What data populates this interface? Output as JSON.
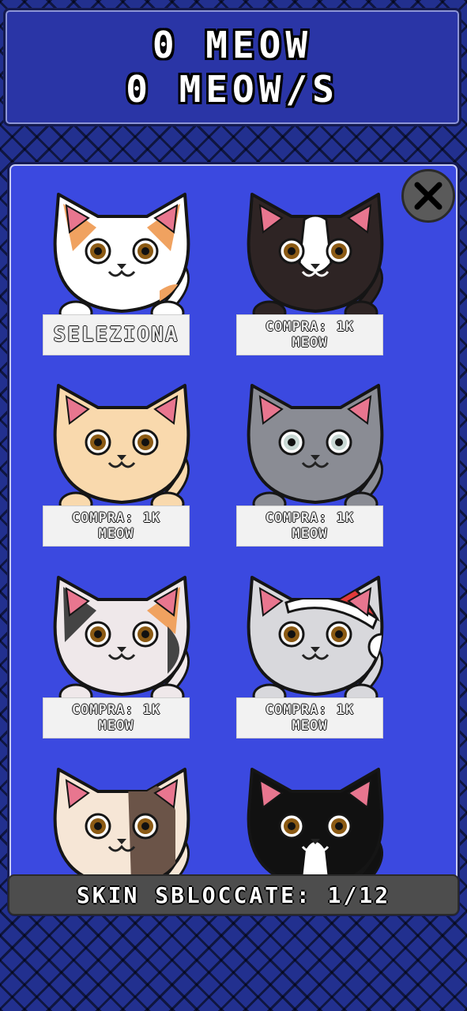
{
  "header": {
    "meow_total": "0 MEOW",
    "meow_rate": "0 MEOW/S"
  },
  "panel": {
    "close_icon": "close-x-icon",
    "skins": [
      {
        "name_icon": "orange-white-cat",
        "button": "SELEZIONA",
        "selected": true,
        "colors": {
          "fur": "#ffffff",
          "patch": "#f0a260"
        }
      },
      {
        "name_icon": "tuxedo-cat",
        "button": "COMPRA: 1K\nMEOW",
        "selected": false,
        "colors": {
          "fur": "#2e2424",
          "patch": "#ffffff"
        }
      },
      {
        "name_icon": "cream-tabby-cat",
        "button": "COMPRA: 1K\nMEOW",
        "selected": false,
        "colors": {
          "fur": "#f9d9ad",
          "patch": "#e6b27c"
        }
      },
      {
        "name_icon": "grey-cat",
        "button": "COMPRA: 1K\nMEOW",
        "selected": false,
        "colors": {
          "fur": "#8a8c94",
          "patch": "#8a8c94"
        }
      },
      {
        "name_icon": "calico-cat",
        "button": "COMPRA: 1K\nMEOW",
        "selected": false,
        "colors": {
          "fur": "#efe8ea",
          "patch": "#444444"
        }
      },
      {
        "name_icon": "santa-hat-grey-cat",
        "button": "COMPRA: 1K\nMEOW",
        "selected": false,
        "colors": {
          "fur": "#d8d8dc",
          "patch": "#e23a3a"
        }
      },
      {
        "name_icon": "brown-patch-cat",
        "button": "",
        "selected": false,
        "colors": {
          "fur": "#f6e6d6",
          "patch": "#6b5448"
        }
      },
      {
        "name_icon": "black-white-cat",
        "button": "",
        "selected": false,
        "colors": {
          "fur": "#111111",
          "patch": "#ffffff"
        }
      }
    ]
  },
  "footer": {
    "unlocked_label": "SKIN SBLOCCATE: 1/12"
  },
  "colors": {
    "background": "#22308f",
    "header_bg": "#2a35a6",
    "panel_bg": "#3b49e0",
    "button_bg": "#f2f2f2",
    "footer_bg": "#4d4d4d"
  }
}
